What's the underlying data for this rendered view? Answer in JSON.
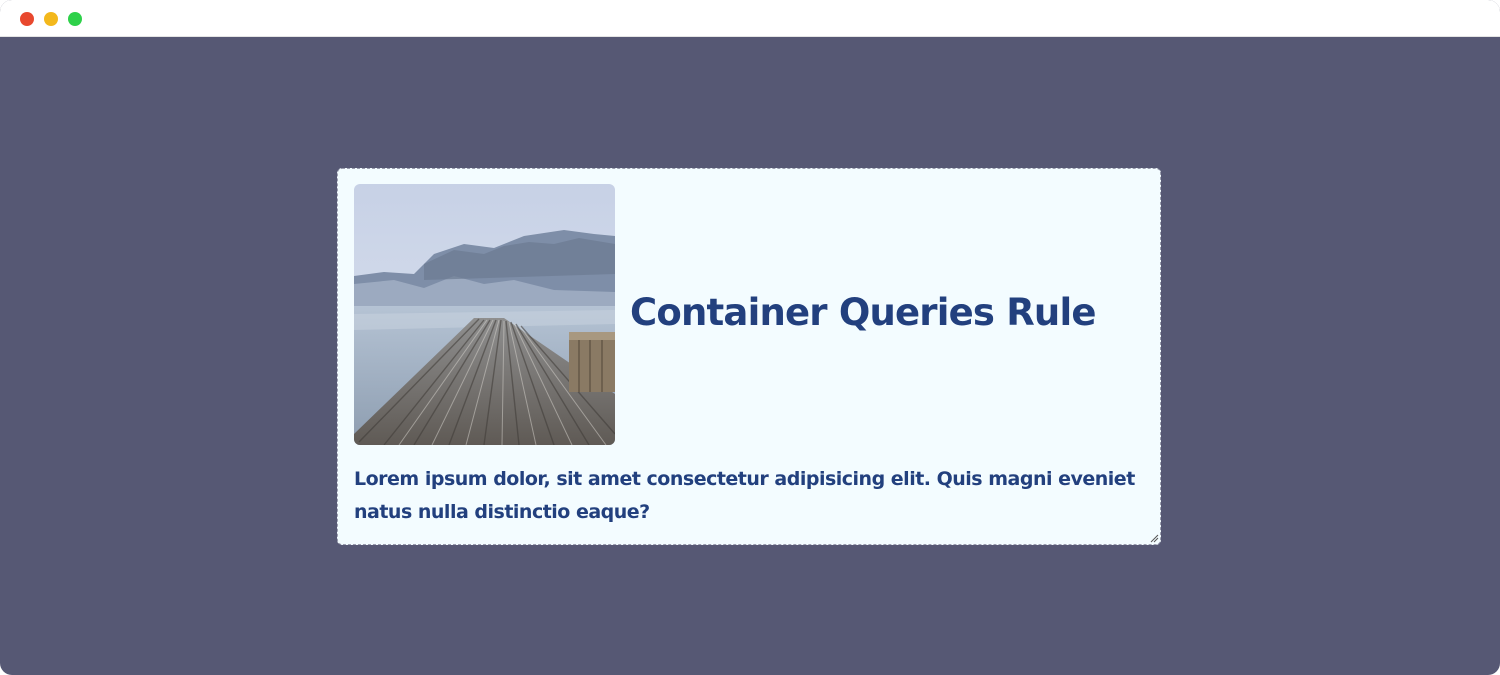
{
  "window": {
    "controls": [
      "close",
      "minimize",
      "maximize"
    ],
    "colors": {
      "close": "#e8482e",
      "minimize": "#f3b81c",
      "maximize": "#2ed14a",
      "background": "#565874"
    }
  },
  "card": {
    "image_alt": "wooden pier over a mountain lake",
    "title": "Container Queries Rule",
    "body": "Lorem ipsum dolor, sit amet consectetur adipisicing elit. Quis magni eveniet natus nulla distinctio eaque?",
    "colors": {
      "background": "#f3fcff",
      "text": "#22407e",
      "border": "#9a9cae"
    }
  },
  "icons": {
    "resize": "resize-grip-icon"
  }
}
